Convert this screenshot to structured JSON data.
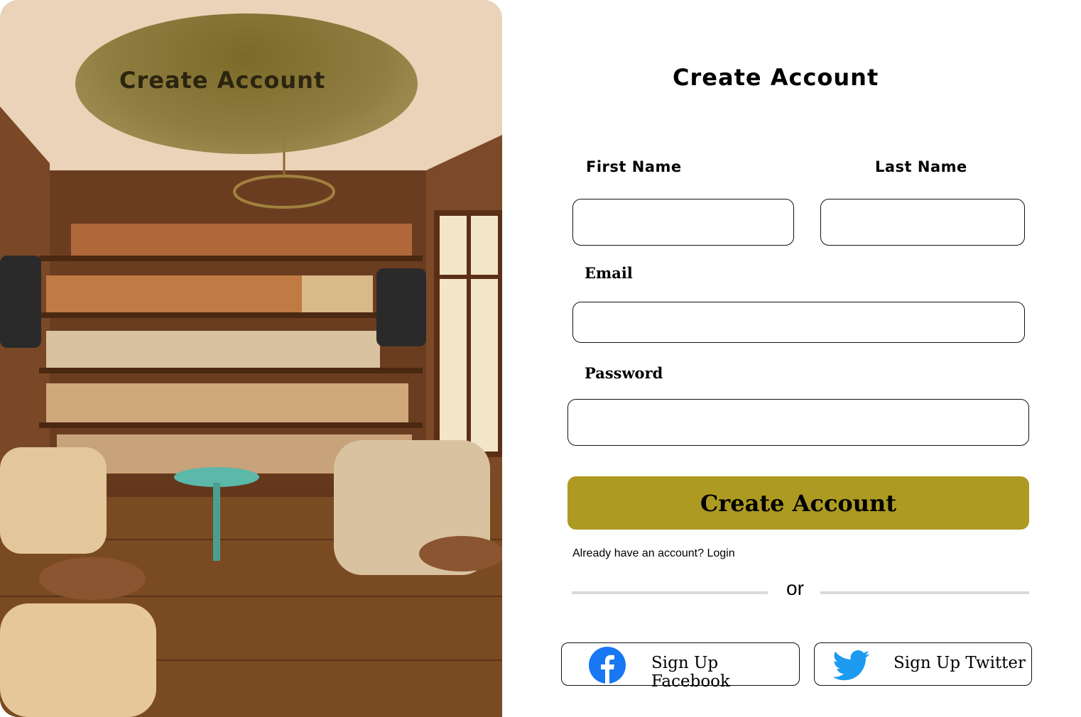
{
  "hero": {
    "overlay_title": "Create Account"
  },
  "form": {
    "title": "Create Account",
    "first_name_label": "First Name",
    "last_name_label": "Last Name",
    "email_label": "Email",
    "password_label": "Password",
    "first_name_value": "",
    "last_name_value": "",
    "email_value": "",
    "password_value": "",
    "submit_label": "Create Account",
    "login_prompt": "Already have an  account? Login",
    "or_label": "or",
    "facebook_label": "Sign Up Facebook",
    "twitter_label": "Sign Up Twitter",
    "facebook_icon": "facebook-icon",
    "twitter_icon": "twitter-icon"
  },
  "colors": {
    "accent": "#ad9a22",
    "facebook": "#1877f2",
    "twitter": "#1d9bf0",
    "divider": "#d9d9d9"
  }
}
